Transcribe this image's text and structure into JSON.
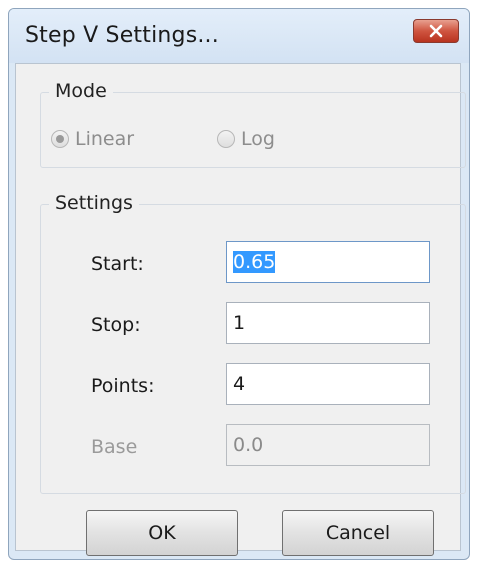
{
  "window": {
    "title": "Step V Settings..."
  },
  "mode": {
    "group_title": "Mode",
    "options": [
      {
        "label": "Linear",
        "checked": true,
        "enabled": false
      },
      {
        "label": "Log",
        "checked": false,
        "enabled": false
      }
    ]
  },
  "settings": {
    "group_title": "Settings",
    "start": {
      "label": "Start:",
      "value": "0.65"
    },
    "stop": {
      "label": "Stop:",
      "value": "1"
    },
    "points": {
      "label": "Points:",
      "value": "4"
    },
    "base": {
      "label": "Base",
      "value": "0.0"
    }
  },
  "buttons": {
    "ok": "OK",
    "cancel": "Cancel"
  },
  "icons": {
    "close": "close-icon",
    "radio": "radio-icon"
  },
  "colors": {
    "selection": "#3399ff",
    "close_button": "#cf5540",
    "frame": "#dbe8f5"
  }
}
